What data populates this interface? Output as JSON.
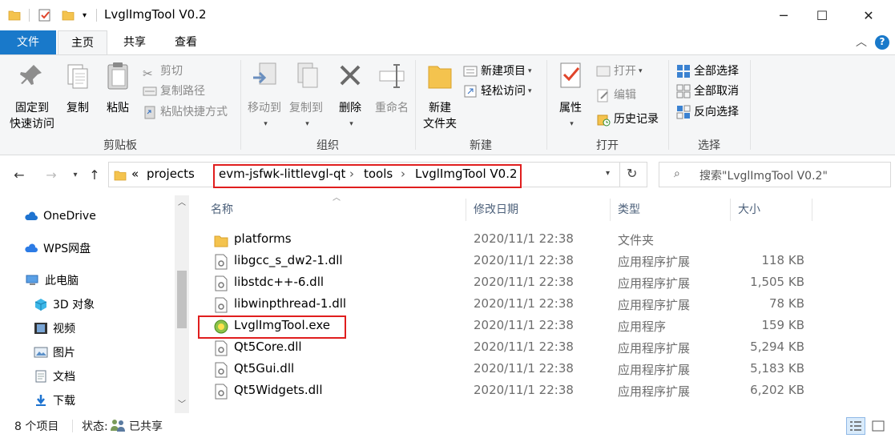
{
  "window": {
    "title": "LvglImgTool V0.2",
    "minimize_glyph": "─",
    "maximize_glyph": "☐",
    "close_glyph": "✕"
  },
  "ribbon_tabs": {
    "file": "文件",
    "home": "主页",
    "share": "共享",
    "view": "查看",
    "collapse_glyph": "︿",
    "help_glyph": "?"
  },
  "ribbon": {
    "clipboard": {
      "group_label": "剪贴板",
      "pin_line1": "固定到",
      "pin_line2": "快速访问",
      "copy": "复制",
      "paste": "粘贴",
      "cut": "剪切",
      "copy_path": "复制路径",
      "paste_shortcut": "粘贴快捷方式"
    },
    "organize": {
      "group_label": "组织",
      "move_to": "移动到",
      "copy_to": "复制到",
      "delete": "删除",
      "rename": "重命名"
    },
    "new": {
      "group_label": "新建",
      "new_folder_line1": "新建",
      "new_folder_line2": "文件夹",
      "new_item": "新建项目",
      "easy_access": "轻松访问"
    },
    "open": {
      "group_label": "打开",
      "properties": "属性",
      "open": "打开",
      "edit": "编辑",
      "history": "历史记录"
    },
    "select": {
      "group_label": "选择",
      "select_all": "全部选择",
      "select_none": "全部取消",
      "invert": "反向选择"
    }
  },
  "address": {
    "overflow": "«",
    "crumbs": [
      "projects",
      "evm-jsfwk-littlevgl-qt",
      "tools",
      "LvglImgTool V0.2"
    ],
    "sep": "›",
    "search_placeholder": "搜索\"LvglImgTool V0.2\""
  },
  "nav_pane": {
    "items": [
      {
        "label": "OneDrive",
        "icon": "cloud-icon"
      },
      {
        "label": "WPS网盘",
        "icon": "cloud-icon"
      },
      {
        "label": "此电脑",
        "icon": "computer-icon"
      },
      {
        "label": "3D 对象",
        "icon": "cube-icon"
      },
      {
        "label": "视频",
        "icon": "video-icon"
      },
      {
        "label": "图片",
        "icon": "picture-icon"
      },
      {
        "label": "文档",
        "icon": "document-icon"
      },
      {
        "label": "下载",
        "icon": "download-icon"
      }
    ]
  },
  "file_list": {
    "columns": {
      "name": "名称",
      "date": "修改日期",
      "type": "类型",
      "size": "大小"
    },
    "sort_glyph": "︿",
    "rows": [
      {
        "name": "platforms",
        "date": "2020/11/1 22:38",
        "type": "文件夹",
        "size": "",
        "icon": "folder-icon"
      },
      {
        "name": "libgcc_s_dw2-1.dll",
        "date": "2020/11/1 22:38",
        "type": "应用程序扩展",
        "size": "118 KB",
        "icon": "dll-icon"
      },
      {
        "name": "libstdc++-6.dll",
        "date": "2020/11/1 22:38",
        "type": "应用程序扩展",
        "size": "1,505 KB",
        "icon": "dll-icon"
      },
      {
        "name": "libwinpthread-1.dll",
        "date": "2020/11/1 22:38",
        "type": "应用程序扩展",
        "size": "78 KB",
        "icon": "dll-icon"
      },
      {
        "name": "LvglImgTool.exe",
        "date": "2020/11/1 22:38",
        "type": "应用程序",
        "size": "159 KB",
        "icon": "exe-icon"
      },
      {
        "name": "Qt5Core.dll",
        "date": "2020/11/1 22:38",
        "type": "应用程序扩展",
        "size": "5,294 KB",
        "icon": "dll-icon"
      },
      {
        "name": "Qt5Gui.dll",
        "date": "2020/11/1 22:38",
        "type": "应用程序扩展",
        "size": "5,183 KB",
        "icon": "dll-icon"
      },
      {
        "name": "Qt5Widgets.dll",
        "date": "2020/11/1 22:38",
        "type": "应用程序扩展",
        "size": "6,202 KB",
        "icon": "dll-icon"
      }
    ]
  },
  "status": {
    "count": "8 个项目",
    "state_label": "状态:",
    "state_value": "已共享"
  },
  "colors": {
    "accent": "#1979ca",
    "highlight_border": "#e01e1e",
    "folder": "#f4c34e"
  }
}
